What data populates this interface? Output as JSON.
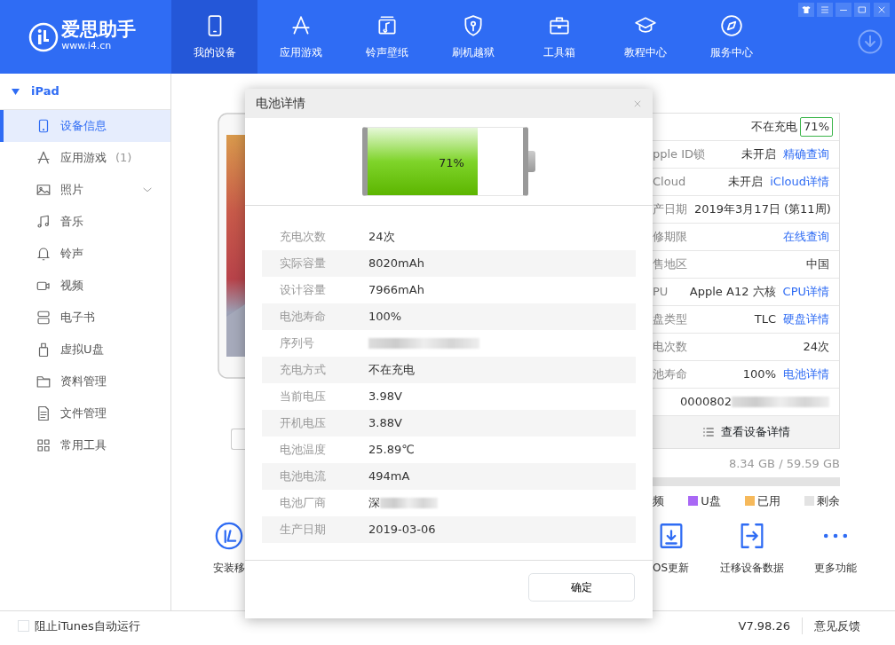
{
  "app": {
    "name": "爱思助手",
    "url": "www.i4.cn"
  },
  "nav_tabs": [
    {
      "label": "我的设备",
      "kind": "phone",
      "selected": true
    },
    {
      "label": "应用游戏",
      "kind": "appstore",
      "selected": false
    },
    {
      "label": "铃声壁纸",
      "kind": "music",
      "selected": false
    },
    {
      "label": "刷机越狱",
      "kind": "shield",
      "selected": false
    },
    {
      "label": "工具箱",
      "kind": "toolbox",
      "selected": false
    },
    {
      "label": "教程中心",
      "kind": "cap",
      "selected": false
    },
    {
      "label": "服务中心",
      "kind": "compass",
      "selected": false
    }
  ],
  "sidebar": {
    "device": "iPad",
    "expanded": true,
    "items": [
      {
        "label": "设备信息",
        "kind": "tablet",
        "selected": true
      },
      {
        "label": "应用游戏",
        "kind": "appstore",
        "count": "(1)",
        "selected": false
      },
      {
        "label": "照片",
        "kind": "photo",
        "expandable": true,
        "selected": false
      },
      {
        "label": "音乐",
        "kind": "note",
        "selected": false
      },
      {
        "label": "铃声",
        "kind": "bell",
        "selected": false
      },
      {
        "label": "视频",
        "kind": "video",
        "selected": false
      },
      {
        "label": "电子书",
        "kind": "book",
        "selected": false
      },
      {
        "label": "虚拟U盘",
        "kind": "usb",
        "selected": false
      },
      {
        "label": "资料管理",
        "kind": "folder",
        "selected": false
      },
      {
        "label": "文件管理",
        "kind": "file",
        "selected": false
      },
      {
        "label": "常用工具",
        "kind": "grid",
        "selected": false
      }
    ]
  },
  "info_panel": {
    "charge_status": "不在充电",
    "battery_badge": "71%",
    "rows": [
      {
        "label": "pple ID锁",
        "value": "未开启",
        "link": "精确查询"
      },
      {
        "label": "Cloud",
        "value": "未开启",
        "link": "iCloud详情"
      },
      {
        "label": "产日期",
        "value": "2019年3月17日 (第11周)"
      },
      {
        "label": "修期限",
        "link": "在线查询"
      },
      {
        "label": "售地区",
        "value": "中国"
      },
      {
        "label": "PU",
        "value": "Apple A12 六核",
        "link": "CPU详情"
      },
      {
        "label": "盘类型",
        "value": "TLC",
        "link": "硬盘详情"
      },
      {
        "label": "电次数",
        "value": "24次"
      },
      {
        "label": "池寿命",
        "value": "100%",
        "link": "电池详情"
      },
      {
        "value": "0000802",
        "redacted": true
      }
    ],
    "details_button": "查看设备详情",
    "storage": "8.34 GB / 59.59 GB",
    "legend": [
      {
        "label": "频"
      },
      {
        "label": "U盘",
        "color": "#a968f5"
      },
      {
        "label": "已用",
        "color": "#f6b95b"
      },
      {
        "label": "剩余",
        "color": "#e3e3e3"
      }
    ]
  },
  "actions": [
    {
      "label": "安装移",
      "kind": "install"
    },
    {
      "label": "OS更新",
      "kind": "update"
    },
    {
      "label": "迁移设备数据",
      "kind": "transfer"
    },
    {
      "label": "更多功能",
      "kind": "more"
    }
  ],
  "status_bar": {
    "checkbox": {
      "label": "阻止iTunes自动运行",
      "checked": false
    },
    "version": "V7.98.26",
    "feedback": "意见反馈"
  },
  "dialog": {
    "title": "电池详情",
    "battery": {
      "level": 0.71,
      "reading": "71%"
    },
    "rows": [
      {
        "label": "充电次数",
        "value": "24次"
      },
      {
        "label": "实际容量",
        "value": "8020mAh"
      },
      {
        "label": "设计容量",
        "value": "7966mAh"
      },
      {
        "label": "电池寿命",
        "value": "100%"
      },
      {
        "label": "序列号",
        "redacted": true
      },
      {
        "label": "充电方式",
        "value": "不在充电"
      },
      {
        "label": "当前电压",
        "value": "3.98V"
      },
      {
        "label": "开机电压",
        "value": "3.88V"
      },
      {
        "label": "电池温度",
        "value": "25.89℃"
      },
      {
        "label": "电池电流",
        "value": "494mA"
      },
      {
        "label": "电池厂商",
        "value": "深",
        "redacted": true
      },
      {
        "label": "生产日期",
        "value": "2019-03-06"
      }
    ],
    "button": "确定"
  }
}
